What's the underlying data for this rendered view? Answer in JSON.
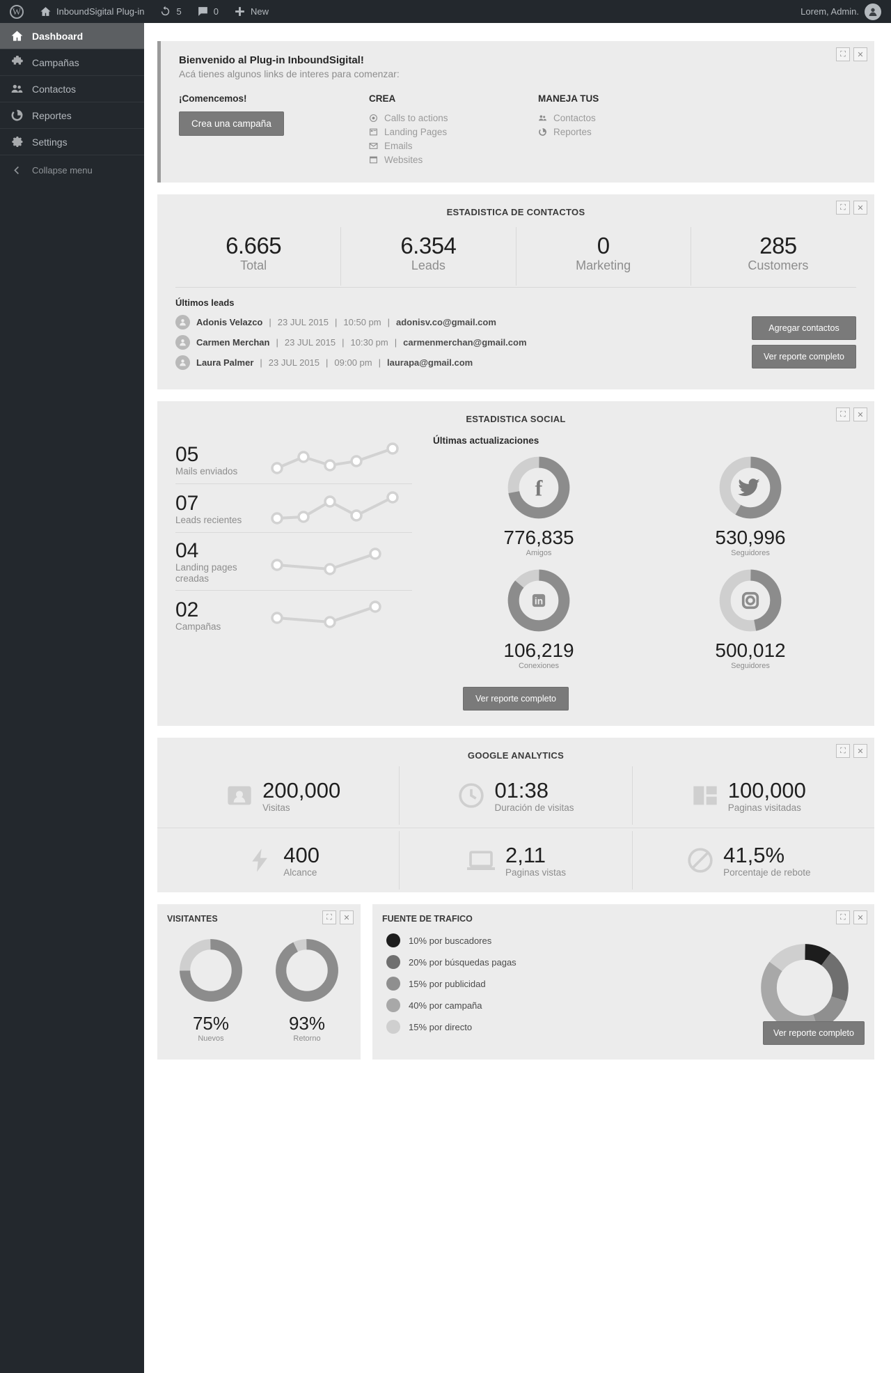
{
  "adminbar": {
    "site_name": "InboundSigital Plug-in",
    "updates_count": "5",
    "comments_count": "0",
    "new_label": "New",
    "user_label": "Lorem, Admin."
  },
  "sidebar": {
    "items": [
      {
        "label": "Dashboard",
        "icon": "home-icon",
        "current": true
      },
      {
        "label": "Campañas",
        "icon": "puzzle-icon",
        "current": false
      },
      {
        "label": "Contactos",
        "icon": "users-icon",
        "current": false
      },
      {
        "label": "Reportes",
        "icon": "pie-icon",
        "current": false
      },
      {
        "label": "Settings",
        "icon": "gear-icon",
        "current": false
      }
    ],
    "collapse_label": "Collapse menu"
  },
  "welcome": {
    "title": "Bienvenido al Plug-in InboundSigital!",
    "subtitle": "Acá tienes algunos links de interes para comenzar:",
    "start_heading": "¡Comencemos!",
    "start_button": "Crea una campaña",
    "crea_heading": "CREA",
    "crea_links": [
      {
        "label": "Calls to actions",
        "icon": "target-icon"
      },
      {
        "label": "Landing Pages",
        "icon": "page-icon"
      },
      {
        "label": "Emails",
        "icon": "envelope-icon"
      },
      {
        "label": "Websites",
        "icon": "window-icon"
      }
    ],
    "manage_heading": "MANEJA TUS",
    "manage_links": [
      {
        "label": "Contactos",
        "icon": "users-icon"
      },
      {
        "label": "Reportes",
        "icon": "pie-icon"
      }
    ]
  },
  "contacts_panel": {
    "title": "ESTADISTICA DE CONTACTOS",
    "stats": [
      {
        "value": "6.665",
        "label": "Total"
      },
      {
        "value": "6.354",
        "label": "Leads"
      },
      {
        "value": "0",
        "label": "Marketing"
      },
      {
        "value": "285",
        "label": "Customers"
      }
    ],
    "leads_heading": "Últimos leads",
    "leads": [
      {
        "name": "Adonis Velazco",
        "date": "23 JUL 2015",
        "time": "10:50 pm",
        "email": "adonisv.co@gmail.com"
      },
      {
        "name": "Carmen Merchan",
        "date": "23 JUL 2015",
        "time": "10:30 pm",
        "email": "carmenmerchan@gmail.com"
      },
      {
        "name": "Laura Palmer",
        "date": "23 JUL 2015",
        "time": "09:00 pm",
        "email": "laurapa@gmail.com"
      }
    ],
    "add_button": "Agregar contactos",
    "report_button": "Ver reporte completo"
  },
  "social_panel": {
    "title": "ESTADISTICA SOCIAL",
    "metrics": [
      {
        "value": "05",
        "label": "Mails enviados"
      },
      {
        "value": "07",
        "label": "Leads recientes"
      },
      {
        "value": "04",
        "label": "Landing pages creadas"
      },
      {
        "value": "02",
        "label": "Campañas"
      }
    ],
    "updates_heading": "Últimas actualizaciones",
    "networks": [
      {
        "network": "facebook",
        "icon": "facebook-icon",
        "value": "776,835",
        "label": "Amigos",
        "percent": 72
      },
      {
        "network": "twitter",
        "icon": "twitter-icon",
        "value": "530,996",
        "label": "Seguidores",
        "percent": 58
      },
      {
        "network": "linkedin",
        "icon": "linkedin-icon",
        "value": "106,219",
        "label": "Conexiones",
        "percent": 86
      },
      {
        "network": "instagram",
        "icon": "instagram-icon",
        "value": "500,012",
        "label": "Seguidores",
        "percent": 47
      }
    ],
    "report_button": "Ver reporte completo"
  },
  "analytics_panel": {
    "title": "GOOGLE ANALYTICS",
    "metrics_row1": [
      {
        "value": "200,000",
        "label": "Visitas",
        "icon": "contact-card-icon"
      },
      {
        "value": "01:38",
        "label": "Duración de visitas",
        "icon": "clock-icon"
      },
      {
        "value": "100,000",
        "label": "Paginas visitadas",
        "icon": "layout-icon"
      }
    ],
    "metrics_row2": [
      {
        "value": "400",
        "label": "Alcance",
        "icon": "bolt-icon"
      },
      {
        "value": "2,11",
        "label": "Paginas vistas",
        "icon": "laptop-icon"
      },
      {
        "value": "41,5%",
        "label": "Porcentaje de rebote",
        "icon": "no-entry-icon"
      }
    ]
  },
  "visitors_panel": {
    "title": "VISITANTES",
    "items": [
      {
        "value": "75%",
        "label": "Nuevos",
        "percent": 75
      },
      {
        "value": "93%",
        "label": "Retorno",
        "percent": 93
      }
    ]
  },
  "traffic_panel": {
    "title": "FUENTE DE TRAFICO",
    "legend": [
      {
        "label": "10% por buscadores",
        "color": "#1d1d1d",
        "percent": 10
      },
      {
        "label": "20% por búsquedas pagas",
        "color": "#6f6f6f",
        "percent": 20
      },
      {
        "label": "15% por publicidad",
        "color": "#8f8f8f",
        "percent": 15
      },
      {
        "label": "40% por campaña",
        "color": "#a8a8a8",
        "percent": 40
      },
      {
        "label": "15% por directo",
        "color": "#cfcfcf",
        "percent": 15
      }
    ],
    "report_button": "Ver reporte completo"
  },
  "chart_data": [
    {
      "type": "pie",
      "title": "FUENTE DE TRAFICO",
      "categories": [
        "por buscadores",
        "por búsquedas pagas",
        "por publicidad",
        "por campaña",
        "por directo"
      ],
      "values": [
        10,
        20,
        15,
        40,
        15
      ],
      "colors": [
        "#1d1d1d",
        "#6f6f6f",
        "#8f8f8f",
        "#a8a8a8",
        "#cfcfcf"
      ],
      "legend": "left"
    },
    {
      "type": "pie",
      "title": "VISITANTES",
      "categories": [
        "Nuevos",
        "Retorno"
      ],
      "values": [
        75,
        93
      ],
      "legend": "none"
    },
    {
      "type": "line",
      "title": "Mails enviados",
      "x": [
        1,
        2,
        3,
        4,
        5
      ],
      "values": [
        30,
        62,
        38,
        48,
        88
      ],
      "ylim": [
        0,
        100
      ]
    },
    {
      "type": "line",
      "title": "Leads recientes",
      "x": [
        1,
        2,
        3,
        4,
        5
      ],
      "values": [
        20,
        25,
        70,
        28,
        85
      ],
      "ylim": [
        0,
        100
      ]
    },
    {
      "type": "line",
      "title": "Landing pages creadas",
      "x": [
        1,
        2,
        3
      ],
      "values": [
        45,
        30,
        82
      ],
      "ylim": [
        0,
        100
      ]
    },
    {
      "type": "line",
      "title": "Campañas",
      "x": [
        1,
        2,
        3
      ],
      "values": [
        45,
        35,
        85
      ],
      "ylim": [
        0,
        100
      ]
    }
  ]
}
